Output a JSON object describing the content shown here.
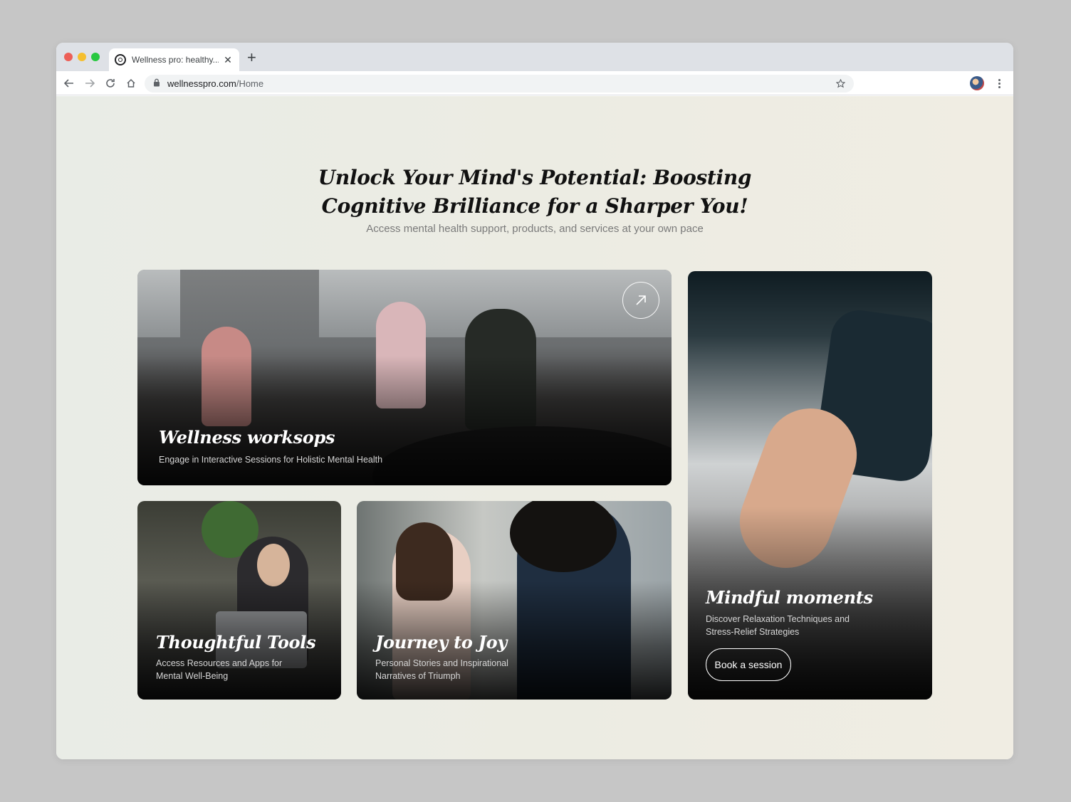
{
  "browser": {
    "tab_title": "Wellness pro: healthy...",
    "tab_close_icon": "close-icon",
    "new_tab_symbol": "+",
    "url_host": "wellnesspro.com",
    "url_path": "/Home"
  },
  "hero": {
    "title": "Unlock Your Mind's Potential: Boosting Cognitive Brilliance for a Sharper You!",
    "subtitle": "Access mental health support, products, and services at your own pace"
  },
  "cards": {
    "workshops": {
      "title": "Wellness worksops",
      "description": "Engage in Interactive Sessions for Holistic Mental Health",
      "action_icon": "arrow-up-right-icon"
    },
    "tools": {
      "title": "Thoughtful Tools",
      "description": "Access Resources and Apps for Mental Well-Being"
    },
    "journey": {
      "title": "Journey to Joy",
      "description": "Personal Stories and Inspirational Narratives of Triumph"
    },
    "mindful": {
      "title": "Mindful moments",
      "description": "Discover Relaxation Techniques and Stress-Relief Strategies",
      "button_label": "Book a session"
    }
  },
  "colors": {
    "page_background": "#ecece3",
    "text_dark": "#111111",
    "text_muted": "#7a7a7a"
  }
}
